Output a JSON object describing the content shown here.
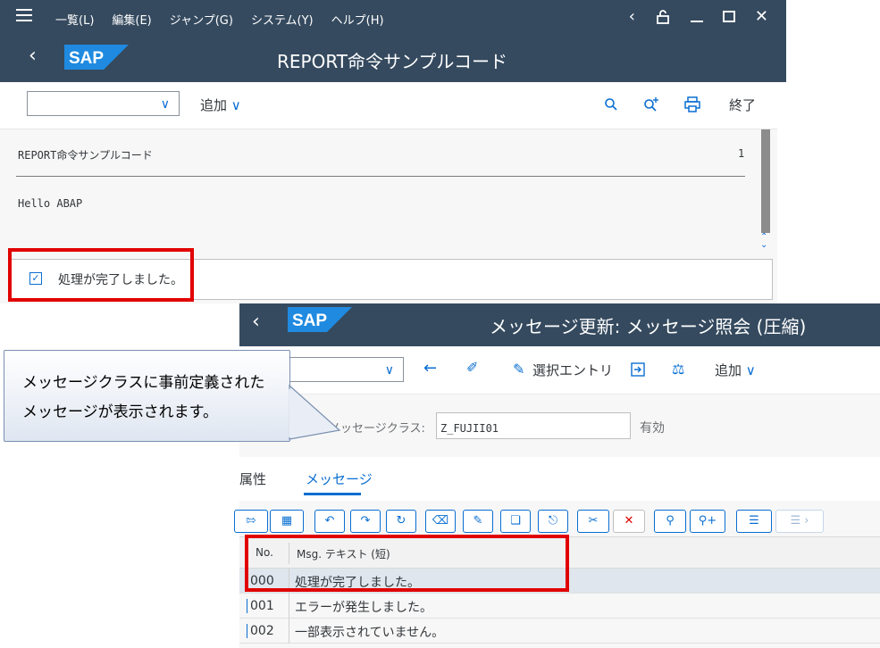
{
  "window1": {
    "menu": [
      "一覧(L)",
      "編集(E)",
      "ジャンプ(G)",
      "システム(Y)",
      "ヘルプ(H)"
    ],
    "title": "REPORT命令サンプルコード",
    "toolbar": {
      "add_label": "追加",
      "exit_label": "終了"
    },
    "list": {
      "title_line": "REPORT命令サンプルコード",
      "page_number": "1",
      "line1": "Hello ABAP"
    },
    "status_message": "処理が完了しました。"
  },
  "window2": {
    "title": "メッセージ更新: メッセージ照会 (圧縮)",
    "toolbar": {
      "select_entry_label": "選択エントリ",
      "add_label": "追加"
    },
    "message_class_label": "メッセージクラス:",
    "message_class_value": "Z_FUJII01",
    "message_class_status": "有効",
    "tabs": [
      "属性",
      "メッセージ"
    ],
    "grid": {
      "columns": [
        "No.",
        "Msg. テキスト (短)"
      ],
      "rows": [
        {
          "no": "000",
          "text": "処理が完了しました。"
        },
        {
          "no": "001",
          "text": "エラーが発生しました。"
        },
        {
          "no": "002",
          "text": "一部表示されていません。"
        }
      ]
    }
  },
  "callout": {
    "line1": "メッセージクラスに事前定義された",
    "line2": "メッセージが表示されます。"
  },
  "colors": {
    "shell": "#354a5f",
    "accent": "#0a6ed1",
    "highlight": "#e10000"
  },
  "sap_logo": "SAP"
}
